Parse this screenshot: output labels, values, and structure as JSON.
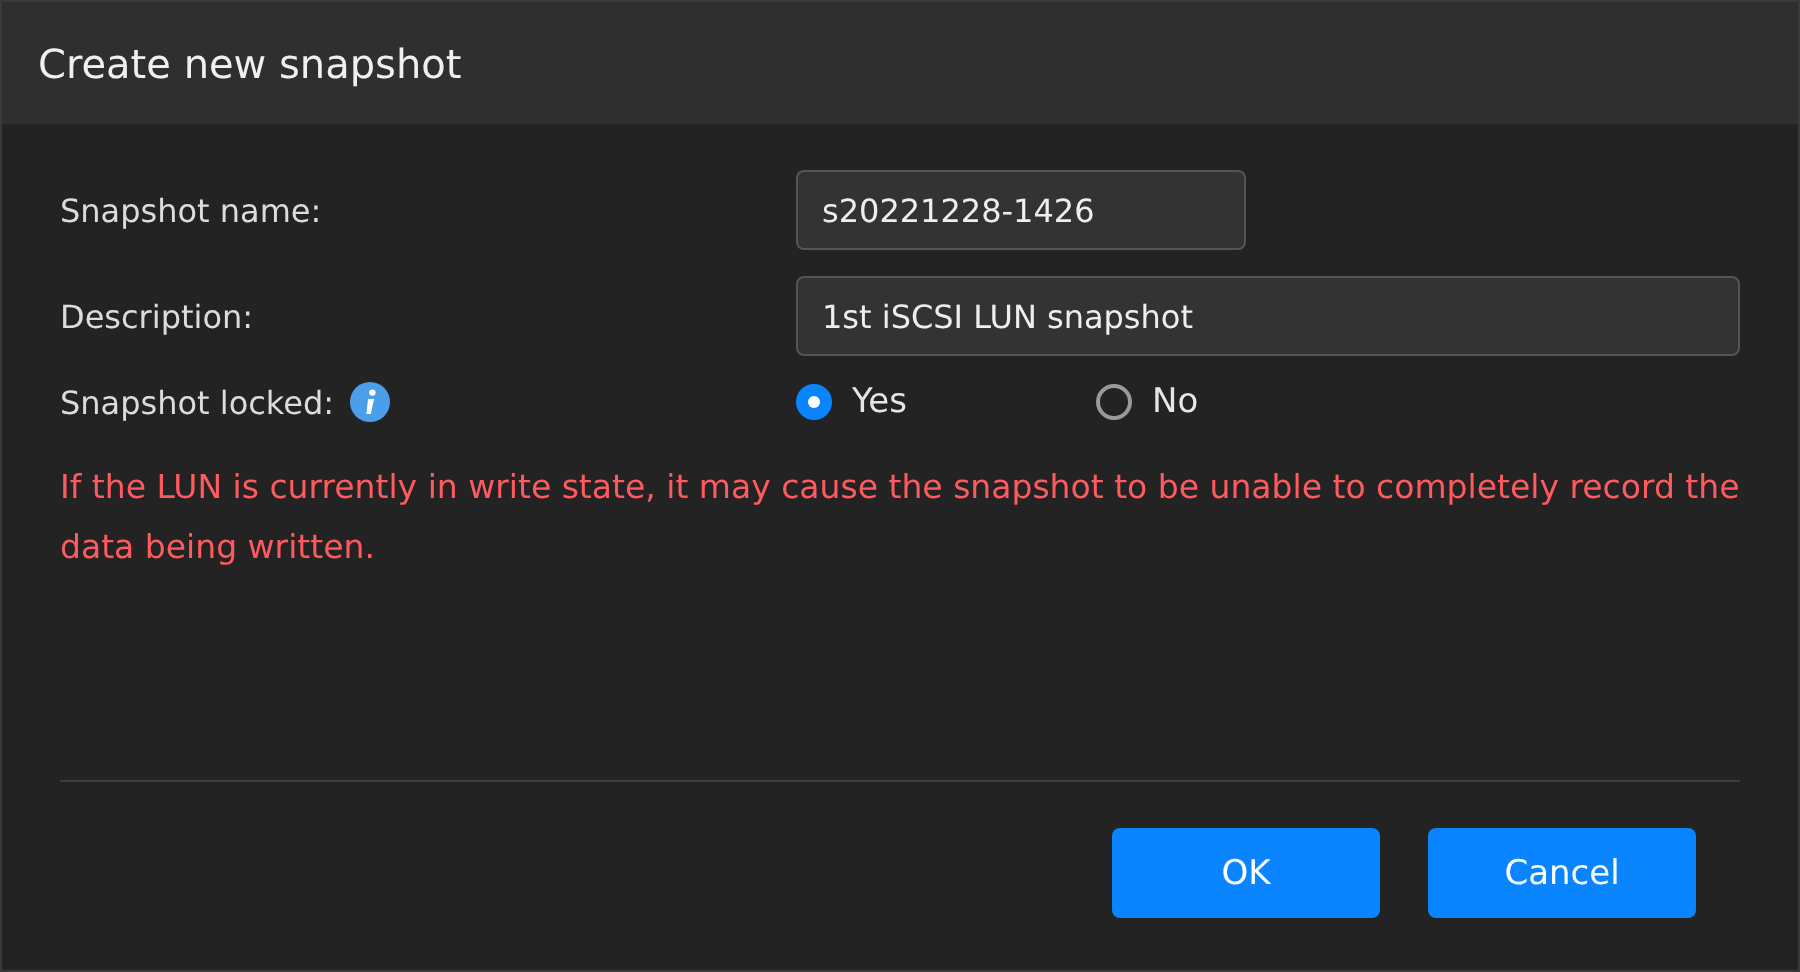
{
  "window": {
    "title": "Create new snapshot"
  },
  "fields": [
    {
      "label": "Snapshot name:",
      "value": "s20221228-1426"
    },
    {
      "label": "Description:",
      "value": "1st iSCSI LUN snapshot"
    }
  ],
  "locked": {
    "label": "Snapshot locked:",
    "options": [
      {
        "label": "Yes",
        "selected": true
      },
      {
        "label": "No",
        "selected": false
      }
    ]
  },
  "warning": "If the LUN is currently in write state, it may cause the snapshot to be unable to completely record the data being written.",
  "buttons": [
    {
      "label": "OK"
    },
    {
      "label": "Cancel"
    }
  ]
}
